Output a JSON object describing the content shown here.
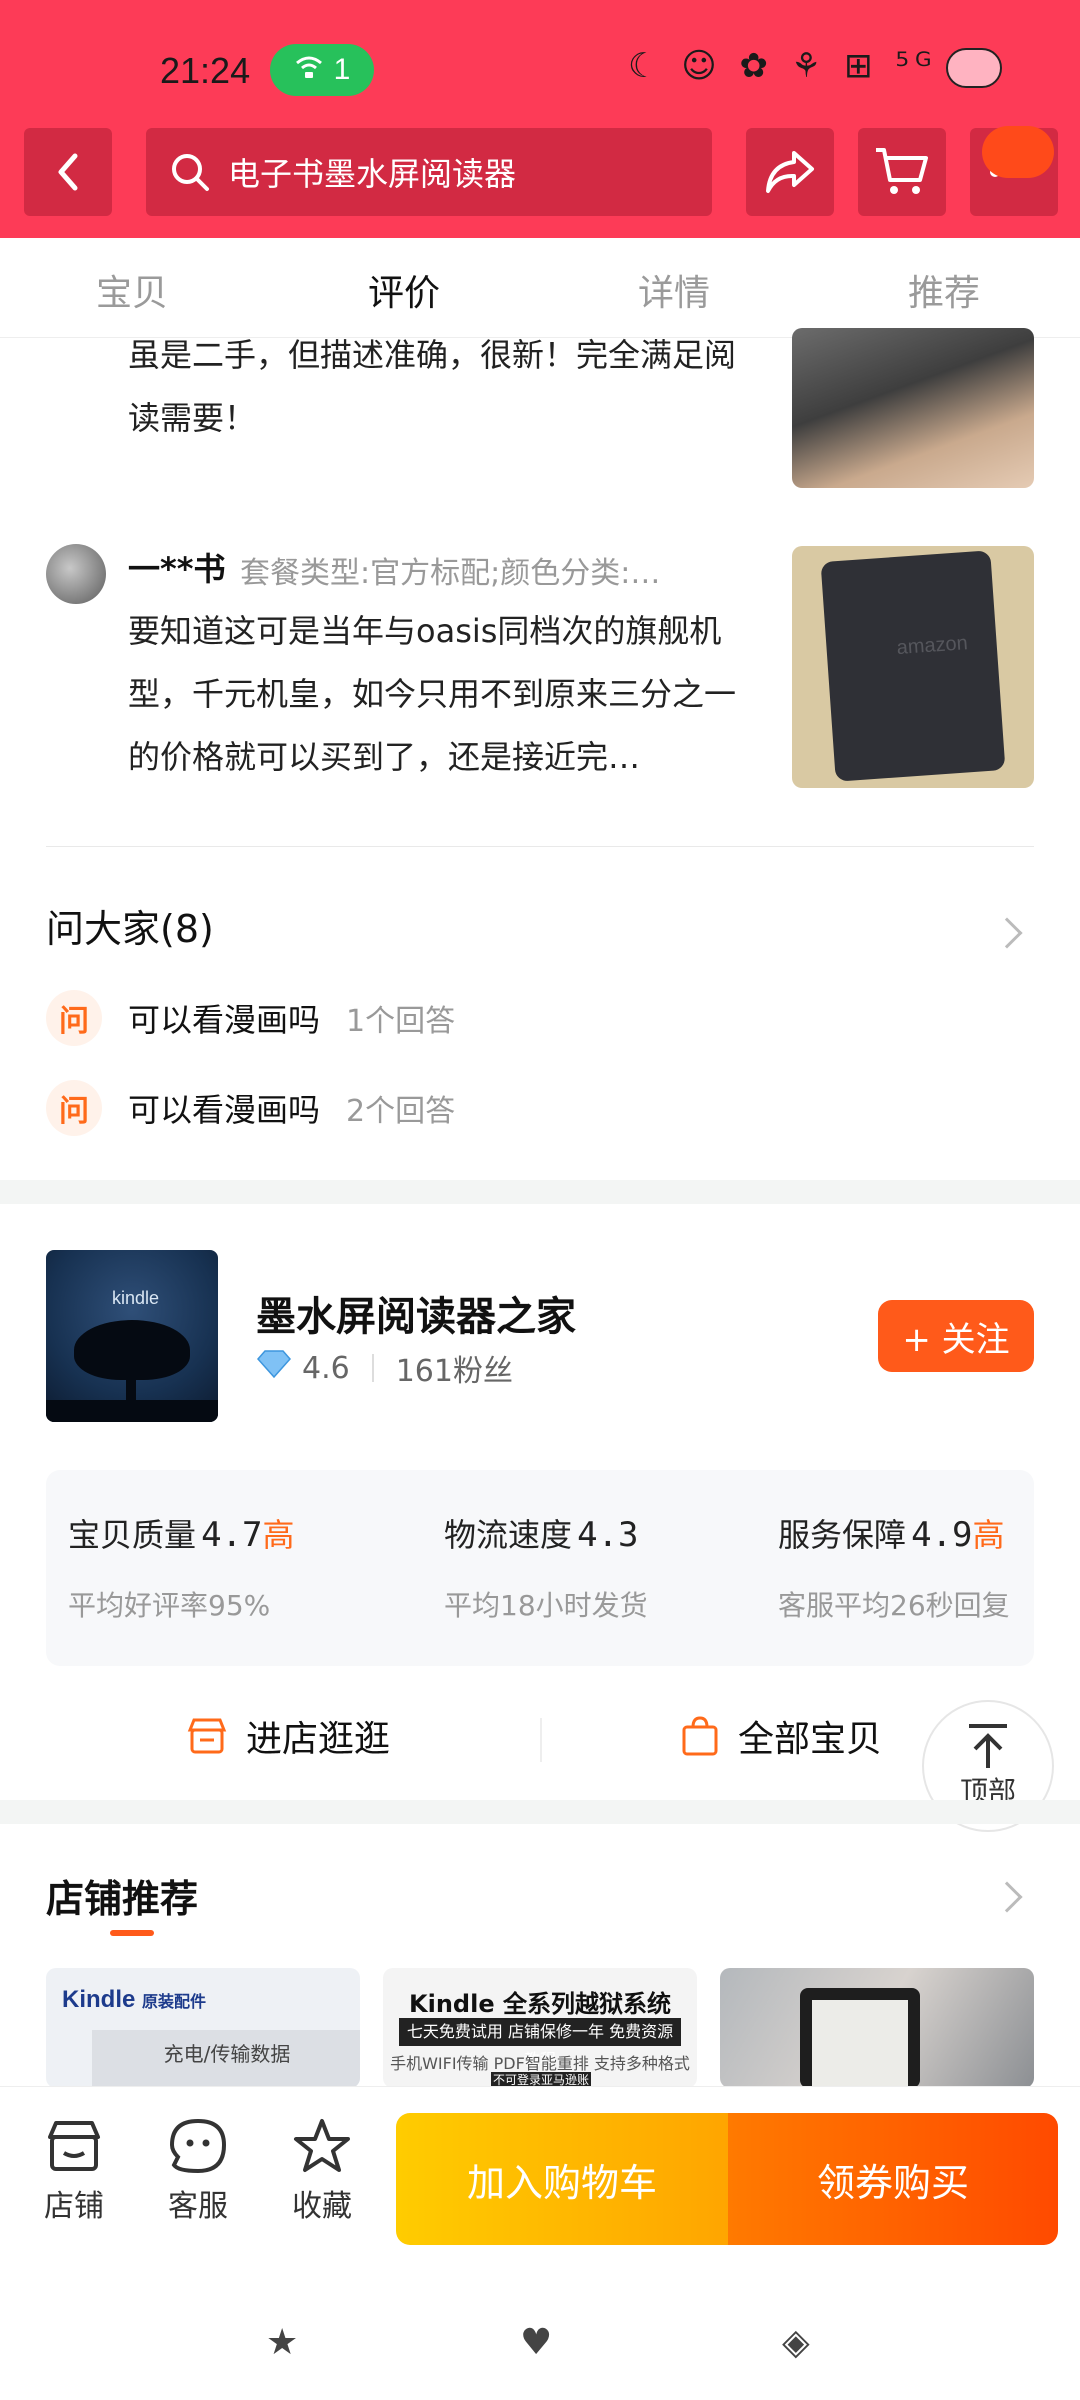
{
  "status": {
    "time": "21:24",
    "wifi_count": "1"
  },
  "search": {
    "query": "电子书墨水屏阅读器"
  },
  "tabs": [
    "宝贝",
    "评价",
    "详情",
    "推荐"
  ],
  "reviews": [
    {
      "text_partial": "虽是二手，但描述准确，很新！完全满足阅读需要！"
    },
    {
      "user": "一**书",
      "spec": "套餐类型:官方标配;颜色分类:…",
      "text": "要知道这可是当年与oasis同档次的旗舰机型，千元机皇，如今只用不到原来三分之一的价格就可以买到了，还是接近完…"
    }
  ],
  "ask": {
    "title": "问大家(8)",
    "badge": "问",
    "items": [
      {
        "q": "可以看漫画吗",
        "n": "1个回答"
      },
      {
        "q": "可以看漫画吗",
        "n": "2个回答"
      }
    ]
  },
  "shop": {
    "logo_text": "kindle",
    "name": "墨水屏阅读器之家",
    "rating": "4.6",
    "fans": "161粉丝",
    "follow": "+ 关注",
    "scores": [
      {
        "label": "宝贝质量",
        "value": "4.7",
        "level": "高",
        "sub": "平均好评率95%"
      },
      {
        "label": "物流速度",
        "value": "4.3",
        "level": "",
        "sub": "平均18小时发货"
      },
      {
        "label": "服务保障",
        "value": "4.9",
        "level": "高",
        "sub": "客服平均26秒回复"
      }
    ],
    "enter": "进店逛逛",
    "all_items": "全部宝贝"
  },
  "back_to_top": "顶部",
  "recommend": {
    "title": "店铺推荐",
    "card1": {
      "brand": "Kindle",
      "brand_sub": "原装配件",
      "line": "充电/传输数据"
    },
    "card2": {
      "title": "Kindle 全系列越狱系统",
      "tag": "七天免费试用 店铺保修一年 免费资源教程",
      "line": "手机WIFI传输 PDF智能重排 支持多种格式",
      "tag2": "不可登录亚马逊账号"
    }
  },
  "bottom": {
    "shop": "店铺",
    "service": "客服",
    "fav": "收藏",
    "add_cart": "加入购物车",
    "buy": "领券购买"
  },
  "colors": {
    "brand_red": "#fd3b57",
    "accent_orange": "#ff5a1a",
    "cart_yellow": "#ffcc00"
  }
}
